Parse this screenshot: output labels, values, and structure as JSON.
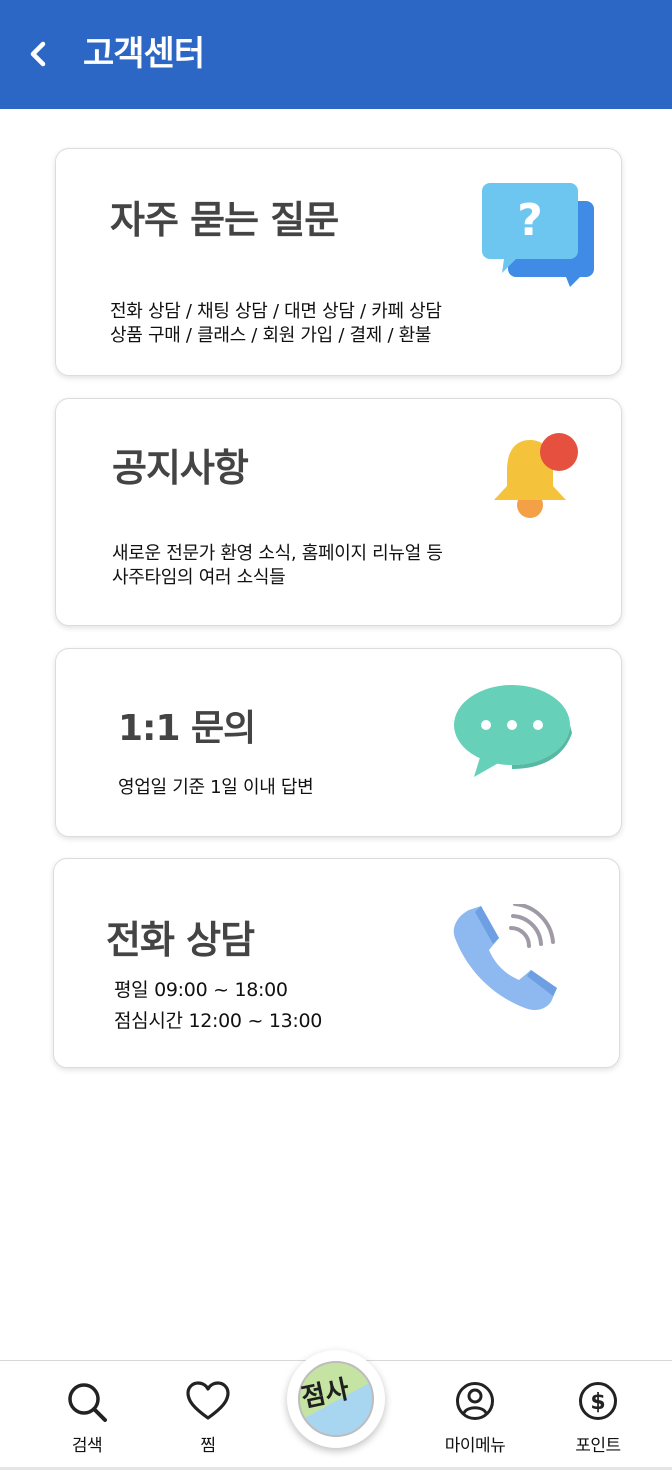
{
  "header": {
    "back_icon": "chevron-left-icon",
    "title": "고객센터",
    "background_color": "#2d67c6"
  },
  "cards": {
    "faq": {
      "title": "자주 묻는 질문",
      "line1": "전화 상담 / 채팅 상담 / 대면 상담 / 카페 상담",
      "line2": "상품 구매 / 클래스 / 회원 가입 / 결제 / 환불",
      "icon": "speech-bubbles-question-icon"
    },
    "notice": {
      "title": "공지사항",
      "line1": "새로운 전문가 환영 소식, 홈페이지 리뉴얼 등",
      "line2": "사주타임의 여러 소식들",
      "icon": "notification-bell-icon"
    },
    "inquiry": {
      "title": "1:1 문의",
      "line1": "영업일 기준 1일 이내 답변",
      "icon": "chat-bubble-icon"
    },
    "phone": {
      "title": "전화 상담",
      "line1": "평일 09:00 ~ 18:00",
      "line2": "점심시간 12:00 ~ 13:00",
      "icon": "phone-ringing-icon"
    }
  },
  "bottom_nav": {
    "search": {
      "label": "검색",
      "icon": "search-icon"
    },
    "favorites": {
      "label": "찜",
      "icon": "heart-icon"
    },
    "center": {
      "logo_text": "점사",
      "icon": "app-logo"
    },
    "my_menu": {
      "label": "마이메뉴",
      "icon": "user-circle-icon"
    },
    "points": {
      "label": "포인트",
      "icon": "dollar-circle-icon"
    }
  }
}
